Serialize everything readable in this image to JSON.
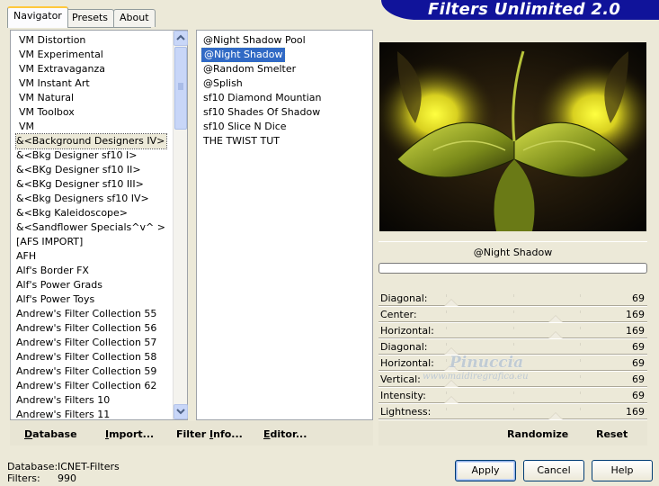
{
  "tabs": [
    {
      "label": "Navigator",
      "active": true
    },
    {
      "label": "Presets",
      "active": false
    },
    {
      "label": "About",
      "active": false
    }
  ],
  "banner": {
    "title": "Filters Unlimited 2.0",
    "color": "#10139a"
  },
  "categories": {
    "items": [
      "VM Distortion",
      "VM Experimental",
      "VM Extravaganza",
      "VM Instant Art",
      "VM Natural",
      "VM Toolbox",
      "VM",
      "&<Background Designers IV>",
      "&<Bkg Designer sf10 I>",
      "&<BKg Designer sf10 II>",
      "&<BKg Designer sf10 III>",
      "&<Bkg Designers sf10 IV>",
      "&<Bkg Kaleidoscope>",
      "&<Sandflower Specials^v^ >",
      "[AFS IMPORT]",
      "AFH",
      "Alf's Border FX",
      "Alf's Power Grads",
      "Alf's Power Toys",
      "Andrew's Filter Collection 55",
      "Andrew's Filter Collection 56",
      "Andrew's Filter Collection 57",
      "Andrew's Filter Collection 58",
      "Andrew's Filter Collection 59",
      "Andrew's Filter Collection 62",
      "Andrew's Filters 10",
      "Andrew's Filters 11"
    ],
    "focused_index": 7
  },
  "filters": {
    "items": [
      "@Night Shadow Pool",
      "@Night Shadow",
      "@Random Smelter",
      "@Splish",
      "sf10 Diamond Mountian",
      "sf10 Shades Of Shadow",
      "sf10 Slice N Dice",
      "THE TWIST TUT"
    ],
    "selected_index": 1
  },
  "preview": {
    "filter_name": "@Night Shadow"
  },
  "sliders": [
    {
      "label": "Diagonal:",
      "value": "69",
      "level": 0.27
    },
    {
      "label": "Center:",
      "value": "169",
      "level": 0.66
    },
    {
      "label": "Horizontal:",
      "value": "169",
      "level": 0.66
    },
    {
      "label": "Diagonal:",
      "value": "69",
      "level": 0.27
    },
    {
      "label": "Horizontal:",
      "value": "69",
      "level": 0.27
    },
    {
      "label": "Vertical:",
      "value": "69",
      "level": 0.27
    },
    {
      "label": "Intensity:",
      "value": "69",
      "level": 0.27
    },
    {
      "label": "Lightness:",
      "value": "169",
      "level": 0.66
    }
  ],
  "toolbar": {
    "database": "Database",
    "import": "Import...",
    "filter_info": "Filter Info...",
    "editor": "Editor...",
    "randomize": "Randomize",
    "reset": "Reset"
  },
  "status": {
    "database_label": "Database:",
    "database_value": "ICNET-Filters",
    "filters_label": "Filters:",
    "filters_value": "990"
  },
  "buttons": {
    "apply": "Apply",
    "cancel": "Cancel",
    "help": "Help"
  },
  "watermark": {
    "name": "Pinuccia",
    "url": "www.maidiregrafica.eu"
  }
}
